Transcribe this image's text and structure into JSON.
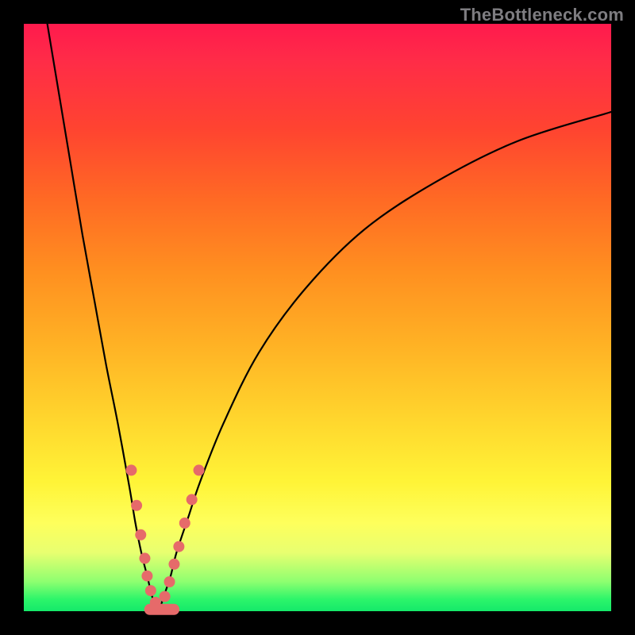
{
  "watermark": "TheBottleneck.com",
  "colors": {
    "frame": "#000000",
    "gradient_top": "#ff1a4d",
    "gradient_bottom": "#15e96a",
    "curve": "#000000",
    "marker": "#e66a6a"
  },
  "chart_data": {
    "type": "line",
    "title": "",
    "xlabel": "",
    "ylabel": "",
    "xlim": [
      0,
      100
    ],
    "ylim": [
      0,
      100
    ],
    "notch_x": 23,
    "series": [
      {
        "name": "left-branch",
        "x": [
          4,
          6,
          8,
          10,
          12,
          14,
          16,
          18,
          19,
          20,
          21,
          22,
          23
        ],
        "y": [
          100,
          88,
          76,
          64,
          53,
          42,
          32,
          21,
          15,
          10,
          6,
          2,
          0
        ]
      },
      {
        "name": "right-branch",
        "x": [
          23,
          24,
          25,
          26,
          28,
          30,
          34,
          40,
          48,
          58,
          70,
          84,
          100
        ],
        "y": [
          0,
          3,
          6,
          10,
          16,
          22,
          32,
          44,
          55,
          65,
          73,
          80,
          85
        ]
      }
    ],
    "markers_left": [
      {
        "x": 18.3,
        "y": 24
      },
      {
        "x": 19.2,
        "y": 18
      },
      {
        "x": 19.9,
        "y": 13
      },
      {
        "x": 20.6,
        "y": 9
      },
      {
        "x": 21.0,
        "y": 6
      },
      {
        "x": 21.6,
        "y": 3.5
      },
      {
        "x": 22.4,
        "y": 1.5
      }
    ],
    "markers_right": [
      {
        "x": 24.0,
        "y": 2.5
      },
      {
        "x": 24.8,
        "y": 5
      },
      {
        "x": 25.6,
        "y": 8
      },
      {
        "x": 26.4,
        "y": 11
      },
      {
        "x": 27.4,
        "y": 15
      },
      {
        "x": 28.6,
        "y": 19
      },
      {
        "x": 29.8,
        "y": 24
      }
    ],
    "bottom_capsule": {
      "x1": 20.5,
      "x2": 26.5,
      "y": 0.3
    }
  }
}
